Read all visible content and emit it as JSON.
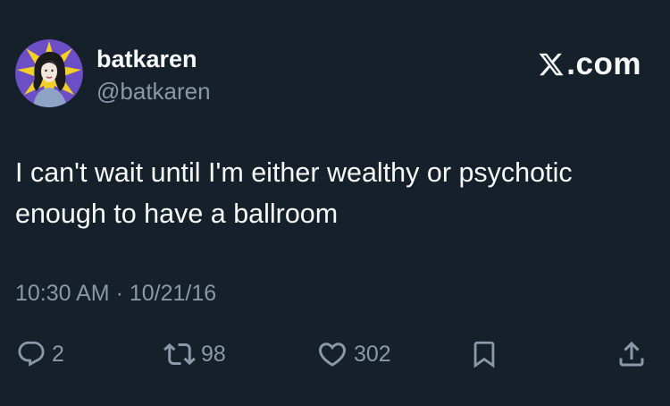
{
  "author": {
    "display_name": "batkaren",
    "handle": "@batkaren",
    "avatar_icon": "avatar-illustration"
  },
  "brand": {
    "logo_icon": "x-logo-icon",
    "text": ".com"
  },
  "tweet": {
    "text": "I can't wait until I'm either wealthy or psychotic enough to have a ballroom",
    "timestamp": "10:30 AM · 10/21/16"
  },
  "actions": {
    "reply": {
      "icon": "reply-icon",
      "count": "2"
    },
    "repost": {
      "icon": "repost-icon",
      "count": "98"
    },
    "like": {
      "icon": "heart-icon",
      "count": "302"
    },
    "bookmark": {
      "icon": "bookmark-icon"
    },
    "share": {
      "icon": "share-icon"
    }
  },
  "colors": {
    "background": "#15202b",
    "primary_text": "#f7f9f9",
    "secondary_text": "#8b98a5"
  }
}
